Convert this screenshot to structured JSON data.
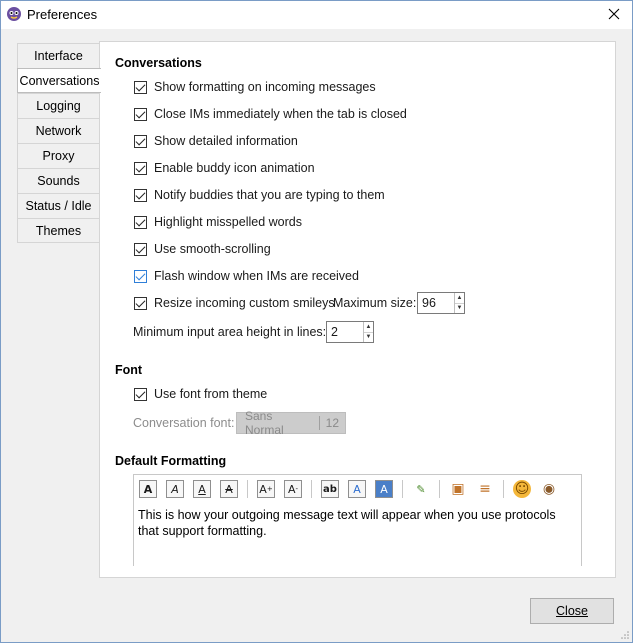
{
  "window": {
    "title": "Preferences"
  },
  "tabs": [
    {
      "label": "Interface"
    },
    {
      "label": "Conversations"
    },
    {
      "label": "Logging"
    },
    {
      "label": "Network"
    },
    {
      "label": "Proxy"
    },
    {
      "label": "Sounds"
    },
    {
      "label": "Status / Idle"
    },
    {
      "label": "Themes"
    }
  ],
  "active_tab": "Conversations",
  "conversations": {
    "title": "Conversations",
    "options": [
      {
        "label": "Show formatting on incoming messages",
        "checked": true
      },
      {
        "label": "Close IMs immediately when the tab is closed",
        "checked": true
      },
      {
        "label": "Show detailed information",
        "checked": true
      },
      {
        "label": "Enable buddy icon animation",
        "checked": true
      },
      {
        "label": "Notify buddies that you are typing to them",
        "checked": true
      },
      {
        "label": "Highlight misspelled words",
        "checked": true
      },
      {
        "label": "Use smooth-scrolling",
        "checked": true
      },
      {
        "label": "Flash window when IMs are received",
        "checked": true
      },
      {
        "label": "Resize incoming custom smileys",
        "checked": true
      }
    ],
    "max_size_label": "Maximum size:",
    "max_size_value": "96",
    "min_input_label": "Minimum input area height in lines:",
    "min_input_value": "2"
  },
  "font": {
    "title": "Font",
    "use_theme_label": "Use font from theme",
    "use_theme_checked": true,
    "conv_font_label": "Conversation font:",
    "font_name": "Sans Normal",
    "font_size": "12"
  },
  "default_formatting": {
    "title": "Default Formatting",
    "toolbar": [
      {
        "icon": "bold-icon",
        "glyph": "A"
      },
      {
        "icon": "italic-icon",
        "glyph": "A"
      },
      {
        "icon": "underline-icon",
        "glyph": "A"
      },
      {
        "icon": "strikethrough-icon",
        "glyph": "A"
      },
      {
        "icon": "grow-font-icon",
        "glyph": "A"
      },
      {
        "icon": "shrink-font-icon",
        "glyph": "A"
      },
      {
        "icon": "font-face-icon",
        "glyph": "ab"
      },
      {
        "icon": "foreground-color-icon",
        "glyph": "A"
      },
      {
        "icon": "background-color-icon",
        "glyph": "A"
      },
      {
        "icon": "reset-formatting-icon",
        "glyph": "✎"
      },
      {
        "icon": "insert-image-icon",
        "glyph": "▣"
      },
      {
        "icon": "insert-rule-icon",
        "glyph": "≡"
      },
      {
        "icon": "smiley-icon",
        "glyph": "☺"
      },
      {
        "icon": "attention-icon",
        "glyph": "◉"
      }
    ],
    "preview_text": "This is how your outgoing message text will appear when you use protocols that support formatting."
  },
  "buttons": {
    "close": "Close"
  },
  "colors": {
    "accent": "#2f7fd8",
    "panel_bg": "#ffffff",
    "window_bg": "#f0f0f0"
  }
}
